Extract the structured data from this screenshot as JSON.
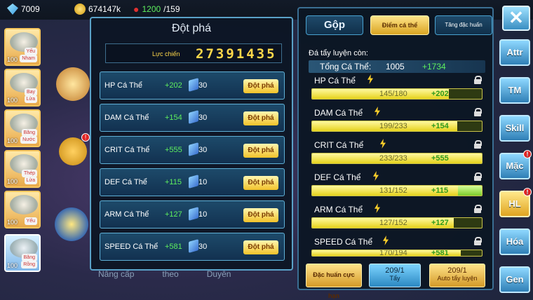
{
  "topbar": {
    "gems": "7009",
    "gold": "674147k",
    "stamina_current": "1200",
    "stamina_max": "/159"
  },
  "heroes": [
    {
      "level": "100",
      "types": [
        "Yếu",
        "Nham"
      ]
    },
    {
      "level": "100",
      "types": [
        "Bay",
        "Lửa"
      ]
    },
    {
      "level": "100",
      "types": [
        "Băng",
        "Nước"
      ]
    },
    {
      "level": "100",
      "types": [
        "Thép",
        "Lửa"
      ]
    },
    {
      "level": "100",
      "types": [
        "Yếu"
      ]
    },
    {
      "level": "100",
      "types": [
        "Băng",
        "Rồng"
      ]
    }
  ],
  "bottom_tabs": [
    "Nâng cấp",
    "theo",
    "Duyên"
  ],
  "breakthrough": {
    "title": "Đột phá",
    "power_label": "Lực chiến",
    "power_value": "27391435",
    "rows": [
      {
        "name": "HP Cá Thể",
        "bonus": "+202",
        "cost": "30",
        "button": "Đột phá"
      },
      {
        "name": "DAM Cá Thể",
        "bonus": "+154",
        "cost": "30",
        "button": "Đột phá"
      },
      {
        "name": "CRIT Cá Thể",
        "bonus": "+555",
        "cost": "30",
        "button": "Đột phá"
      },
      {
        "name": "DEF Cá Thể",
        "bonus": "+115",
        "cost": "10",
        "button": "Đột phá"
      },
      {
        "name": "ARM Cá Thể",
        "bonus": "+127",
        "cost": "10",
        "button": "Đột phá"
      },
      {
        "name": "SPEED Cá Thể",
        "bonus": "+581",
        "cost": "30",
        "button": "Đột phá"
      }
    ]
  },
  "individual": {
    "tabs": {
      "gop": "Gộp",
      "diem": "Điểm cá thể",
      "tang": "Tăng đặc huấn"
    },
    "remaining_label": "Đá tẩy luyện còn:",
    "total_label": "Tổng Cá Thể:",
    "total_value": "1005",
    "total_plus": "+1734",
    "stats": [
      {
        "name": "HP Cá Thể",
        "value": "145/180",
        "plus": "+202",
        "ratio": 0.805
      },
      {
        "name": "DAM Cá Thể",
        "value": "199/233",
        "plus": "+154",
        "ratio": 0.854
      },
      {
        "name": "CRIT Cá Thể",
        "value": "233/233",
        "plus": "+555",
        "ratio": 1.0
      },
      {
        "name": "DEF Cá Thể",
        "value": "131/152",
        "plus": "+115",
        "ratio": 0.862
      },
      {
        "name": "ARM Cá Thể",
        "value": "127/152",
        "plus": "+127",
        "ratio": 0.836
      },
      {
        "name": "SPEED Cá Thể",
        "value": "170/194",
        "plus": "+581",
        "ratio": 0.876
      }
    ],
    "buttons": {
      "dac_huan": "Đặc huấn cực hạn",
      "tay_count": "209/1",
      "tay_label": "Tẩy",
      "auto_count": "209/1",
      "auto_label": "Auto tẩy luyện"
    }
  },
  "side_nav": [
    "Attr",
    "TM",
    "Skill",
    "Mặc",
    "HL",
    "Hóa",
    "Gen"
  ],
  "badge_mark": "!"
}
